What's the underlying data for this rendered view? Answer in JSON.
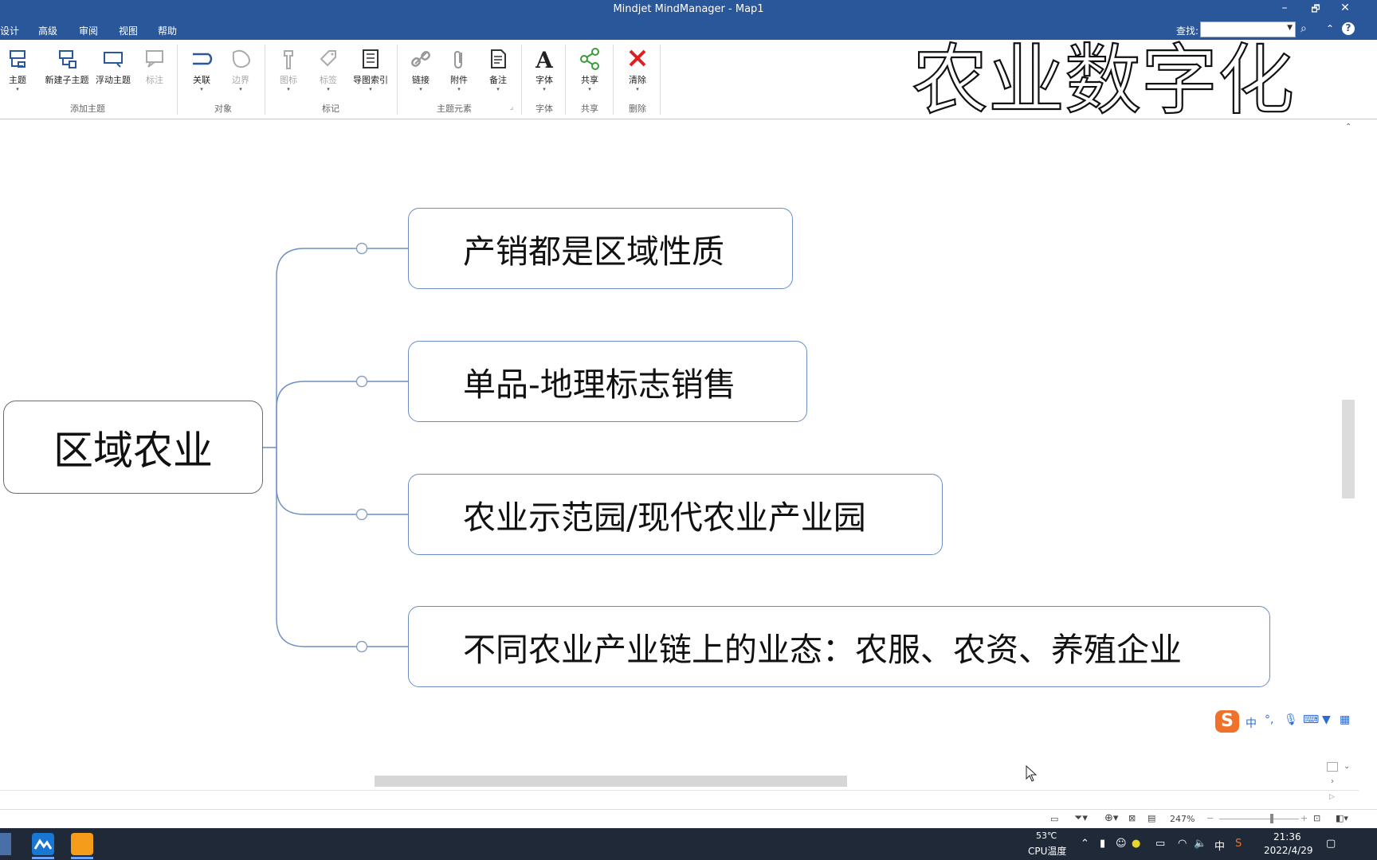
{
  "window": {
    "title": "Mindjet MindManager - Map1"
  },
  "window_controls": {
    "minimize": "–",
    "restore": "🗗",
    "close": "✕"
  },
  "menu": {
    "items": [
      "设计",
      "高级",
      "审阅",
      "视图",
      "帮助"
    ],
    "search_label": "查找:",
    "search_value": ""
  },
  "ribbon": {
    "buttons": {
      "topic": "主题",
      "subtopic": "新建子主题",
      "floating": "浮动主题",
      "callout": "标注",
      "relationship": "关联",
      "boundary": "边界",
      "icon": "图标",
      "tag": "标签",
      "mapindex": "导图索引",
      "link": "链接",
      "attachment": "附件",
      "notes": "备注",
      "font": "字体",
      "share": "共享",
      "clear": "清除"
    },
    "groups": {
      "add_topic": "添加主题",
      "objects": "对象",
      "markers": "标记",
      "topic_elements": "主题元素",
      "font": "字体",
      "share": "共享",
      "delete": "删除"
    }
  },
  "watermark_text": "农业数字化",
  "map": {
    "central": "区域农业",
    "branches": [
      "产销都是区域性质",
      "单品-地理标志销售",
      "农业示范园/现代农业产业园",
      "不同农业产业链上的业态：农服、农资、养殖企业"
    ]
  },
  "ime": {
    "mode": "中"
  },
  "status": {
    "zoom": "247%"
  },
  "taskbar": {
    "temp": "53℃",
    "temp_label": "CPU温度",
    "lang": "中",
    "time": "21:36",
    "date": "2022/4/29"
  }
}
